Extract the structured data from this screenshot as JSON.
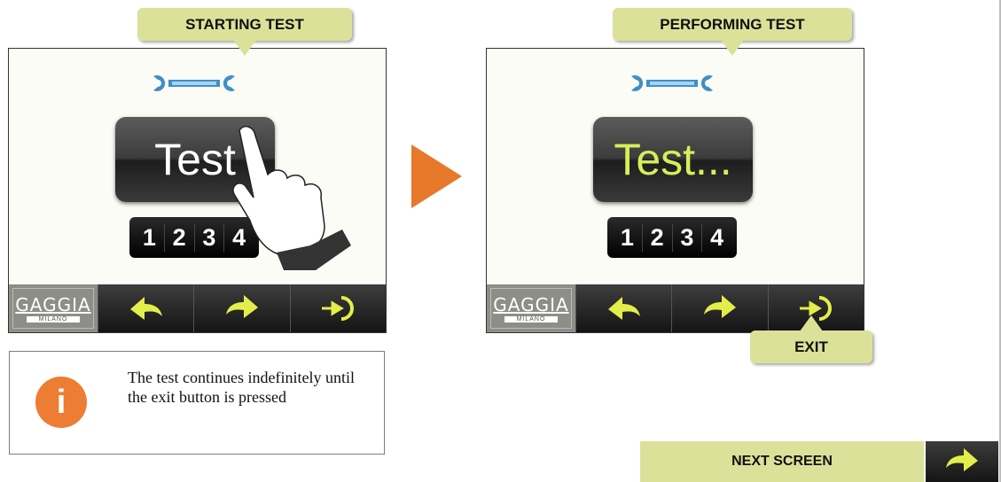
{
  "left_panel": {
    "callout": "STARTING TEST",
    "button_label": "Test",
    "digits": [
      "1",
      "2",
      "3",
      "4"
    ]
  },
  "right_panel": {
    "callout": "PERFORMING TEST",
    "button_label": "Test...",
    "digits": [
      "1",
      "2",
      "3",
      "4"
    ],
    "exit_callout": "EXIT"
  },
  "bottom_bar": {
    "logo_text": "GAGGIA",
    "logo_subtext": "MILANO",
    "icons": [
      "back-arrow-icon",
      "forward-arrow-icon",
      "exit-icon"
    ]
  },
  "info": {
    "icon": "info-icon",
    "text": "The test continues indefinitely until the exit button is pressed"
  },
  "next_screen": {
    "label": "NEXT SCREEN"
  },
  "colors": {
    "callout_bg": "#dce19a",
    "accent_arrow": "#e8782a",
    "info_icon": "#ec7d33",
    "active_text": "#d6ee5a",
    "icon_yellow": "#e3ee4a",
    "wrench_blue": "#3f8fc7"
  }
}
